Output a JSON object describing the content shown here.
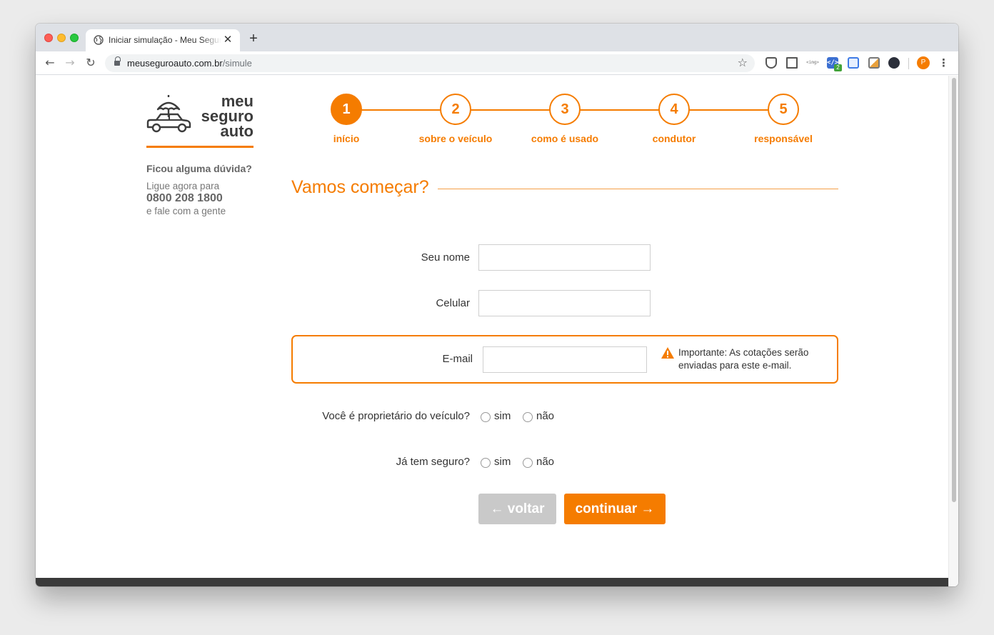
{
  "browser": {
    "tab_title": "Iniciar simulação - Meu Seguro Auto",
    "tab_close": "✕",
    "new_tab": "+",
    "url_domain": "meuseguroauto.com.br",
    "url_path": "/simule",
    "ext_img_label": "<img>",
    "ext_code_label": "</>",
    "ext_code_badge": "2",
    "avatar_letter": "P"
  },
  "logo": {
    "line1": "meu",
    "line2": "seguro",
    "line3": "auto"
  },
  "help": {
    "title": "Ficou alguma dúvida?",
    "line1": "Ligue agora para",
    "phone": "0800 208 1800",
    "line2": "e fale com a gente"
  },
  "steps": [
    {
      "number": "1",
      "label": "início",
      "active": true
    },
    {
      "number": "2",
      "label": "sobre o veículo",
      "active": false
    },
    {
      "number": "3",
      "label": "como é usado",
      "active": false
    },
    {
      "number": "4",
      "label": "condutor",
      "active": false
    },
    {
      "number": "5",
      "label": "responsável",
      "active": false
    }
  ],
  "form": {
    "title": "Vamos começar?",
    "name_label": "Seu nome",
    "name_value": "",
    "phone_label": "Celular",
    "phone_value": "",
    "email_label": "E-mail",
    "email_value": "",
    "email_warning": "Importante: As cotações serão enviadas para este e-mail.",
    "owner_question": "Você é proprietário do veículo?",
    "insured_question": "Já tem seguro?",
    "option_yes": "sim",
    "option_no": "não",
    "back_button": "← voltar",
    "continue_button": "continuar →"
  },
  "colors": {
    "accent": "#f57c00",
    "button_disabled": "#c9c9c9",
    "text": "#333333"
  }
}
